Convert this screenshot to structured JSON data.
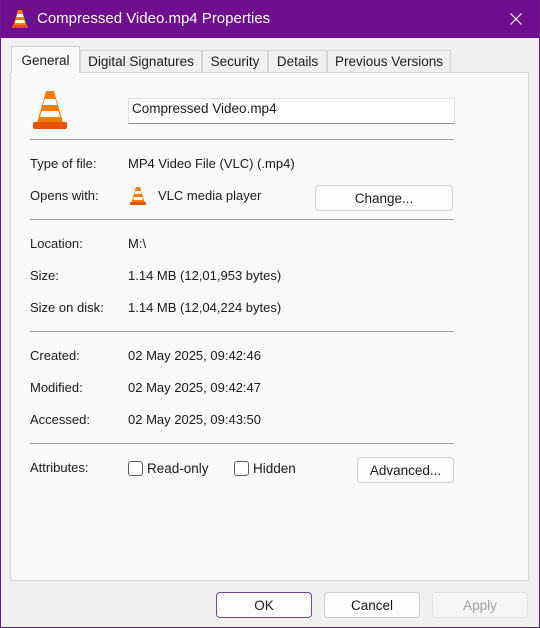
{
  "window": {
    "title": "Compressed Video.mp4 Properties",
    "accent": "#6f0f8e",
    "icon": "vlc-cone-icon"
  },
  "tabs": [
    {
      "label": "General",
      "active": true
    },
    {
      "label": "Digital Signatures",
      "active": false
    },
    {
      "label": "Security",
      "active": false
    },
    {
      "label": "Details",
      "active": false
    },
    {
      "label": "Previous Versions",
      "active": false
    }
  ],
  "general": {
    "file_name": "Compressed Video.mp4",
    "type_label": "Type of file:",
    "type_value": "MP4 Video File (VLC) (.mp4)",
    "opens_label": "Opens with:",
    "opens_value": "VLC media player",
    "change_button": "Change...",
    "location_label": "Location:",
    "location_value": "M:\\",
    "size_label": "Size:",
    "size_value": "1.14 MB (12,01,953 bytes)",
    "size_disk_label": "Size on disk:",
    "size_disk_value": "1.14 MB (12,04,224 bytes)",
    "created_label": "Created:",
    "created_value": "02 May 2025, 09:42:46",
    "modified_label": "Modified:",
    "modified_value": "02 May 2025, 09:42:47",
    "accessed_label": "Accessed:",
    "accessed_value": "02 May 2025, 09:43:50",
    "attributes_label": "Attributes:",
    "readonly_label": "Read-only",
    "readonly_checked": false,
    "hidden_label": "Hidden",
    "hidden_checked": false,
    "advanced_button": "Advanced..."
  },
  "footer": {
    "ok": "OK",
    "cancel": "Cancel",
    "apply": "Apply"
  }
}
